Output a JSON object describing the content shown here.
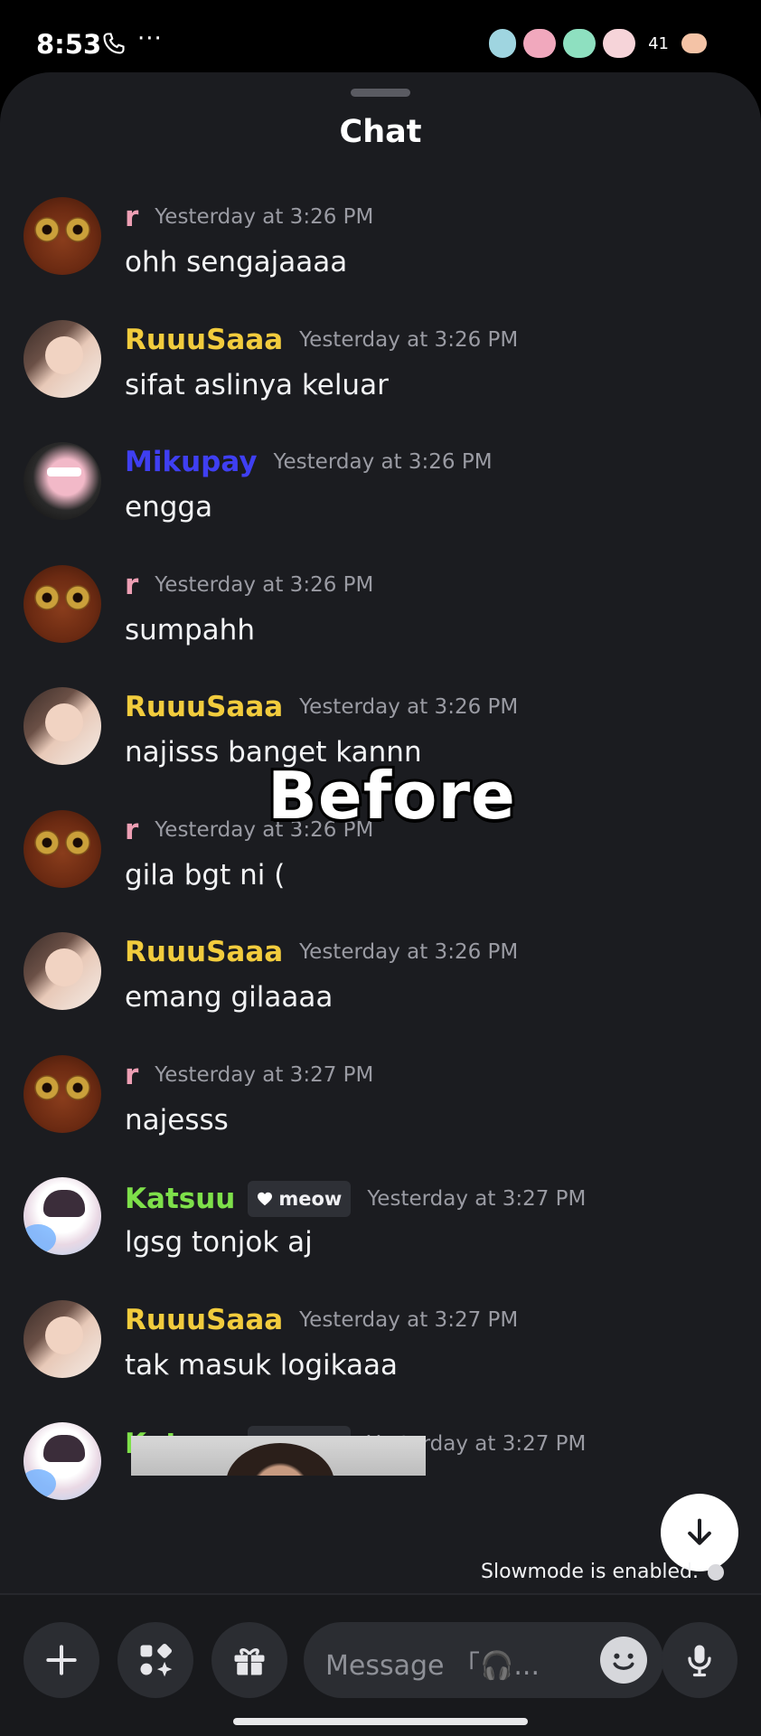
{
  "status_bar": {
    "time": "8:53",
    "dots": "···",
    "battery": "41"
  },
  "header": {
    "title": "Chat"
  },
  "messages": [
    {
      "avatar": "frog",
      "name": "r",
      "name_color": "#ee9fb4",
      "time": "Yesterday at 3:26 PM",
      "text": "ohh sengajaaaa"
    },
    {
      "avatar": "girl",
      "name": "RuuuSaaa",
      "name_color": "#f2cc3d",
      "time": "Yesterday at 3:26 PM",
      "text": "sifat aslinya keluar"
    },
    {
      "avatar": "mask",
      "name": "Mikupay",
      "name_color": "#3f3ff2",
      "time": "Yesterday at 3:26 PM",
      "text": "engga"
    },
    {
      "avatar": "frog",
      "name": "r",
      "name_color": "#ee9fb4",
      "time": "Yesterday at 3:26 PM",
      "text": "sumpahh"
    },
    {
      "avatar": "girl",
      "name": "RuuuSaaa",
      "name_color": "#f2cc3d",
      "time": "Yesterday at 3:26 PM",
      "text": "najisss banget kannn"
    },
    {
      "avatar": "frog",
      "name": "r",
      "name_color": "#ee9fb4",
      "time": "Yesterday at 3:26 PM",
      "text": "gila bgt ni ("
    },
    {
      "avatar": "girl",
      "name": "RuuuSaaa",
      "name_color": "#f2cc3d",
      "time": "Yesterday at 3:26 PM",
      "text": "emang gilaaaa"
    },
    {
      "avatar": "frog",
      "name": "r",
      "name_color": "#ee9fb4",
      "time": "Yesterday at 3:27 PM",
      "text": "najesss"
    },
    {
      "avatar": "anime",
      "name": "Katsuu",
      "name_color": "#7ee04a",
      "tag": "meow",
      "time": "Yesterday at 3:27 PM",
      "text": "lgsg tonjok aj"
    },
    {
      "avatar": "girl",
      "name": "RuuuSaaa",
      "name_color": "#f2cc3d",
      "time": "Yesterday at 3:27 PM",
      "text": "tak masuk logikaaa"
    },
    {
      "avatar": "anime",
      "name": "Katsuu",
      "name_color": "#7ee04a",
      "tag": "meow",
      "time": "Yesterday at 3:27 PM",
      "text": ""
    }
  ],
  "overlay_text": "Before",
  "slowmode": "Slowmode is enabled.",
  "composer": {
    "placeholder": "Message 「🎧..."
  },
  "icons": [
    "call-icon",
    "plus-icon",
    "apps-icon",
    "gift-icon",
    "emoji-icon",
    "mic-icon",
    "arrow-down-icon",
    "clock-icon"
  ]
}
